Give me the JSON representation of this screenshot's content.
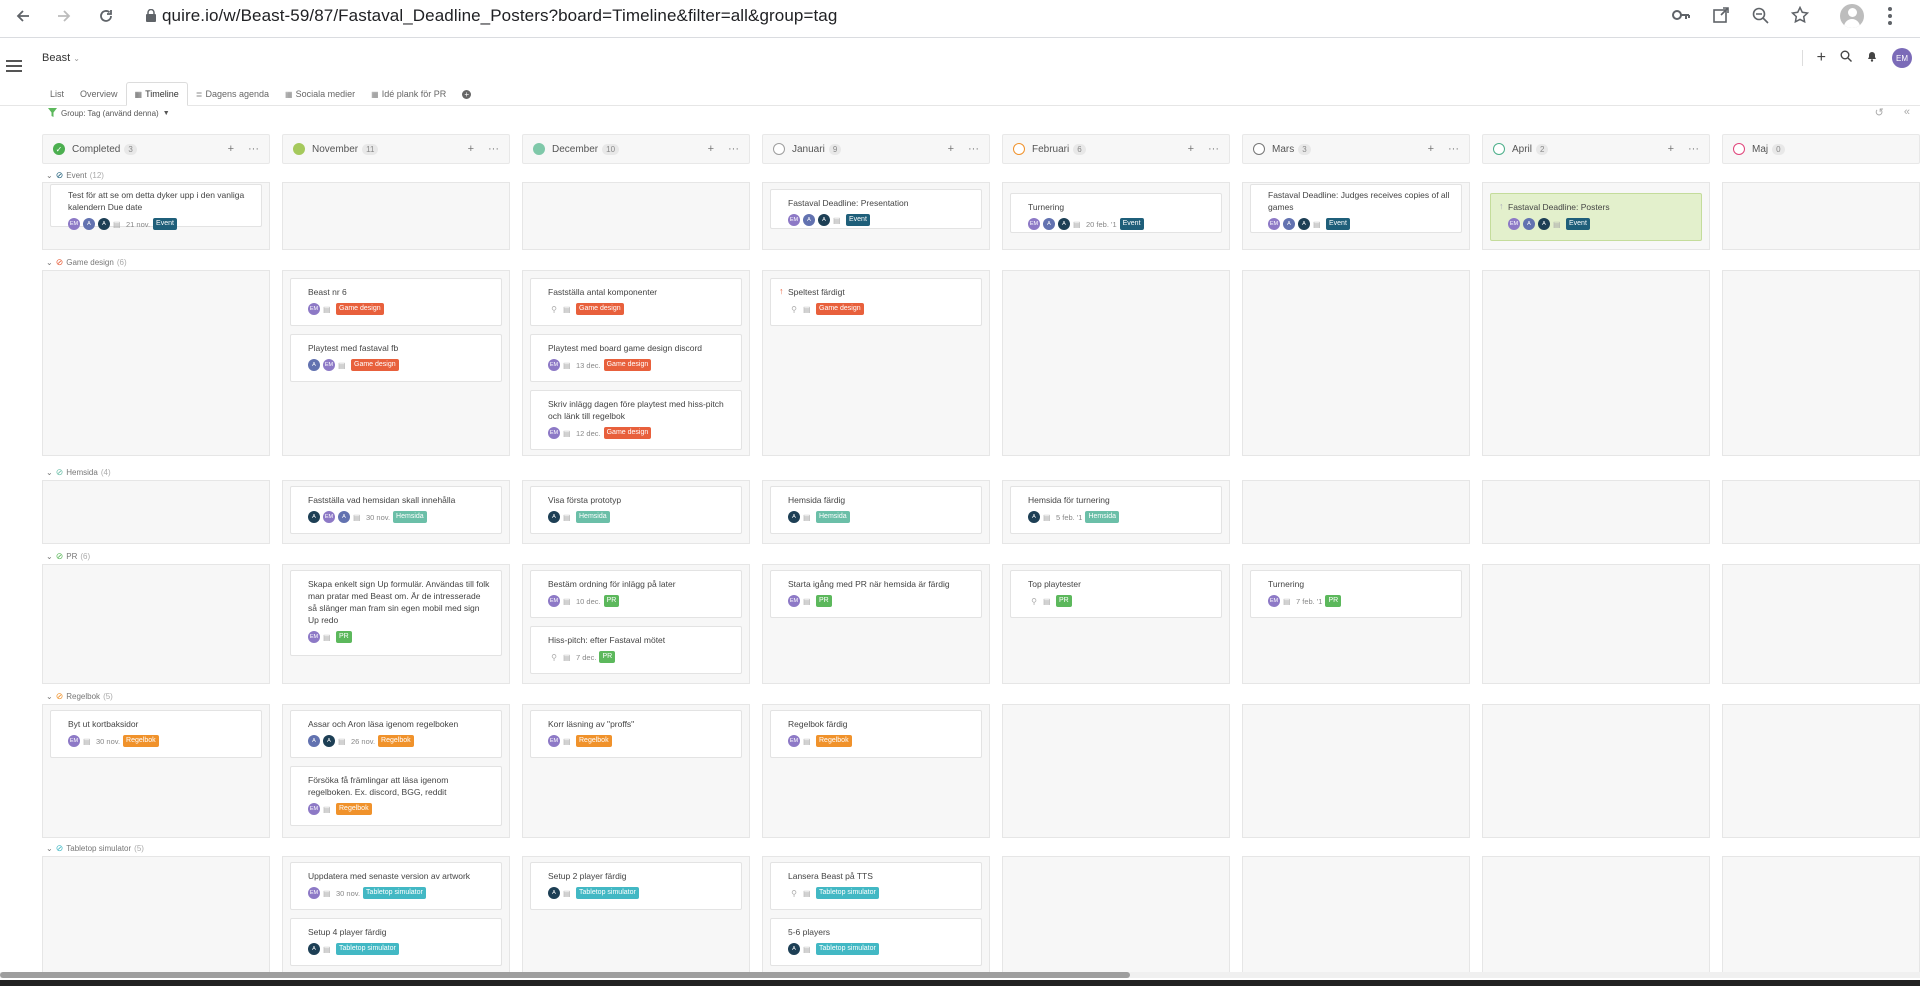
{
  "browser": {
    "url": "quire.io/w/Beast-59/87/Fastaval_Deadline_Posters?board=Timeline&filter=all&group=tag"
  },
  "app": {
    "project_name": "Beast",
    "tabs": [
      {
        "label": "List"
      },
      {
        "label": "Overview"
      },
      {
        "label": "Timeline"
      },
      {
        "label": "Dagens agenda"
      },
      {
        "label": "Sociala medier"
      },
      {
        "label": "Idé plank för PR"
      }
    ],
    "user_initials": "EM",
    "filter_label": "Group: Tag (använd denna)"
  },
  "colors": {
    "event": "#1f5f7a",
    "game_design": "#e8603c",
    "hemsida": "#6bbfa8",
    "pr": "#5cb85c",
    "regelbok": "#f0922b",
    "tabletop": "#42b8c4"
  },
  "columns": [
    {
      "name": "Completed",
      "count": "3",
      "status_color": "#4caf50"
    },
    {
      "name": "November",
      "count": "11",
      "status_color": "#a5c95c"
    },
    {
      "name": "December",
      "count": "10",
      "status_color": "#7fc8a9"
    },
    {
      "name": "Januari",
      "count": "9",
      "status_color": "#9e9e9e"
    },
    {
      "name": "Februari",
      "count": "6",
      "status_color": "#f0922b"
    },
    {
      "name": "Mars",
      "count": "3",
      "status_color": "#777777"
    },
    {
      "name": "April",
      "count": "2",
      "status_color": "#4caf8a"
    },
    {
      "name": "Maj",
      "count": "0",
      "status_color": "#e0457b"
    }
  ],
  "groups": [
    {
      "name": "Event",
      "count": "(12)"
    },
    {
      "name": "Game design",
      "count": "(6)"
    },
    {
      "name": "Hemsida",
      "count": "(4)"
    },
    {
      "name": "PR",
      "count": "(6)"
    },
    {
      "name": "Regelbok",
      "count": "(5)"
    },
    {
      "name": "Tabletop simulator",
      "count": "(5)"
    }
  ],
  "cards": {
    "event_completed": {
      "title": "Test för att se om detta dyker upp i den vanliga kalendern Due date",
      "avatars": [
        "EM",
        "A",
        "A"
      ],
      "due": "21 nov.",
      "tag": "Event"
    },
    "event_jan": {
      "title": "Fastaval Deadline: Presentation",
      "avatars": [
        "EM",
        "A",
        "A"
      ],
      "due": "",
      "tag": "Event"
    },
    "event_feb": {
      "title": "Turnering",
      "avatars": [
        "EM",
        "A",
        "A"
      ],
      "due": "20 feb. '1",
      "tag": "Event"
    },
    "event_mar": {
      "title": "Fastaval Deadline: Judges receives copies of all games",
      "avatars": [
        "EM",
        "A",
        "A"
      ],
      "due": "",
      "tag": "Event"
    },
    "event_apr": {
      "title": "Fastaval Deadline: Posters",
      "avatars": [
        "EM",
        "A",
        "A"
      ],
      "due": "",
      "tag": "Event"
    },
    "gd_nov_1": {
      "title": "Beast nr 6",
      "avatars": [
        "EM"
      ],
      "due": "",
      "tag": "Game design"
    },
    "gd_nov_2": {
      "title": "Playtest med fastaval fb",
      "avatars": [
        "A",
        "EM"
      ],
      "due": "",
      "tag": "Game design"
    },
    "gd_dec_1": {
      "title": "Fastställa antal komponenter",
      "avatars": [],
      "due": "",
      "tag": "Game design"
    },
    "gd_dec_2": {
      "title": "Playtest med board game design discord",
      "avatars": [
        "EM"
      ],
      "due": "13 dec.",
      "tag": "Game design"
    },
    "gd_dec_3": {
      "title": "Skriv inlägg dagen före playtest med hiss-pitch och länk till regelbok",
      "avatars": [
        "EM"
      ],
      "due": "12 dec.",
      "tag": "Game design"
    },
    "gd_jan_1": {
      "title": "Speltest färdigt",
      "avatars": [],
      "due": "",
      "tag": "Game design"
    },
    "hs_nov": {
      "title": "Fastställa vad hemsidan skall innehålla",
      "avatars": [
        "A",
        "EM",
        "A"
      ],
      "due": "30 nov.",
      "tag": "Hemsida"
    },
    "hs_dec": {
      "title": "Visa första prototyp",
      "avatars": [
        "A"
      ],
      "due": "",
      "tag": "Hemsida"
    },
    "hs_jan": {
      "title": "Hemsida färdig",
      "avatars": [
        "A"
      ],
      "due": "",
      "tag": "Hemsida"
    },
    "hs_feb": {
      "title": "Hemsida för turnering",
      "avatars": [
        "A"
      ],
      "due": "5 feb. '1",
      "tag": "Hemsida"
    },
    "pr_nov": {
      "title": "Skapa enkelt sign Up formulär. Användas till folk man pratar med Beast om. Är de intresserade så slänger man fram sin egen mobil med sign Up redo",
      "avatars": [
        "EM"
      ],
      "due": "",
      "tag": "PR"
    },
    "pr_dec_1": {
      "title": "Bestäm ordning för inlägg på later",
      "avatars": [
        "EM"
      ],
      "due": "10 dec.",
      "tag": "PR"
    },
    "pr_dec_2": {
      "title": "Hiss-pitch: efter Fastaval mötet",
      "avatars": [],
      "due": "7 dec.",
      "tag": "PR"
    },
    "pr_jan": {
      "title": "Starta igång med PR när hemsida är färdig",
      "avatars": [
        "EM"
      ],
      "due": "",
      "tag": "PR"
    },
    "pr_feb": {
      "title": "Top playtester",
      "avatars": [],
      "due": "",
      "tag": "PR"
    },
    "pr_mar": {
      "title": "Turnering",
      "avatars": [
        "EM"
      ],
      "due": "7 feb. '1",
      "tag": "PR"
    },
    "rb_completed": {
      "title": "Byt ut kortbaksidor",
      "avatars": [
        "EM"
      ],
      "due": "30 nov.",
      "tag": "Regelbok"
    },
    "rb_nov_1": {
      "title": "Assar och Aron läsa igenom regelboken",
      "avatars": [
        "A",
        "A"
      ],
      "due": "26 nov.",
      "tag": "Regelbok"
    },
    "rb_nov_2": {
      "title": "Försöka få främlingar att läsa igenom regelboken. Ex. discord, BGG, reddit",
      "avatars": [
        "EM"
      ],
      "due": "",
      "tag": "Regelbok"
    },
    "rb_dec": {
      "title": "Korr läsning av \"proffs\"",
      "avatars": [
        "EM"
      ],
      "due": "",
      "tag": "Regelbok"
    },
    "rb_jan": {
      "title": "Regelbok färdig",
      "avatars": [
        "EM"
      ],
      "due": "",
      "tag": "Regelbok"
    },
    "tt_nov_1": {
      "title": "Uppdatera med senaste version av artwork",
      "avatars": [
        "EM"
      ],
      "due": "30 nov.",
      "tag": "Tabletop simulator"
    },
    "tt_nov_2": {
      "title": "Setup 4 player färdig",
      "avatars": [
        "A"
      ],
      "due": "",
      "tag": "Tabletop simulator"
    },
    "tt_dec": {
      "title": "Setup 2 player färdig",
      "avatars": [
        "A"
      ],
      "due": "",
      "tag": "Tabletop simulator"
    },
    "tt_jan_1": {
      "title": "Lansera Beast på TTS",
      "avatars": [],
      "due": "",
      "tag": "Tabletop simulator"
    },
    "tt_jan_2": {
      "title": "5-6 players",
      "avatars": [
        "A"
      ],
      "due": "",
      "tag": "Tabletop simulator"
    }
  }
}
